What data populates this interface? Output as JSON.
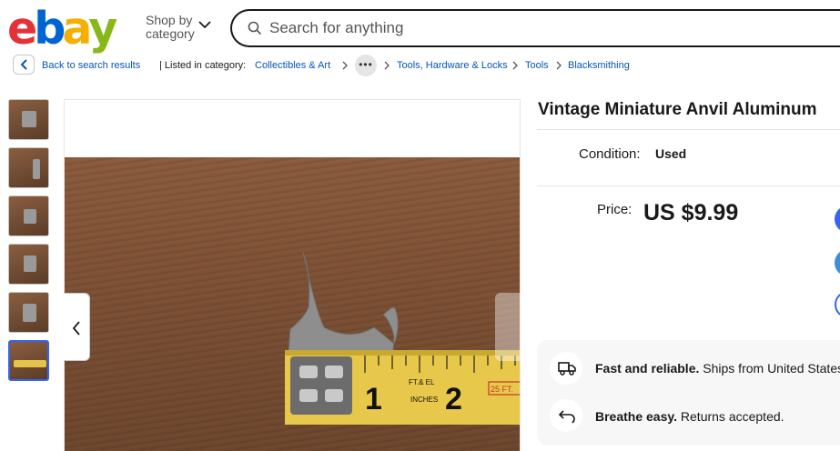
{
  "header": {
    "logo_letters": [
      "e",
      "b",
      "a",
      "y"
    ],
    "logo_colors": [
      "#e53238",
      "#0064d2",
      "#f5af02",
      "#86b817"
    ],
    "shop_by_line1": "Shop by",
    "shop_by_line2": "category",
    "search_placeholder": "Search for anything"
  },
  "breadcrumb": {
    "back_label": "Back to search results",
    "listed_in": "| Listed in category:",
    "items": [
      "Collectibles & Art",
      "Tools, Hardware & Locks",
      "Tools",
      "Blacksmithing"
    ],
    "more": "•••"
  },
  "gallery": {
    "thumbnail_count": 6,
    "active_index": 5
  },
  "listing": {
    "title": "Vintage Miniature Anvil Aluminum",
    "condition_label": "Condition:",
    "condition_value": "Used",
    "price_label": "Price:",
    "price_value": "US $9.99"
  },
  "features": [
    {
      "icon": "truck-icon",
      "bold": "Fast and reliable.",
      "text": " Ships from United States."
    },
    {
      "icon": "return-icon",
      "bold": "Breathe easy.",
      "text": " Returns accepted."
    }
  ],
  "colors": {
    "link": "#0654ba",
    "cta_blue": "#3665f3",
    "thumb_active": "#3665f3"
  }
}
